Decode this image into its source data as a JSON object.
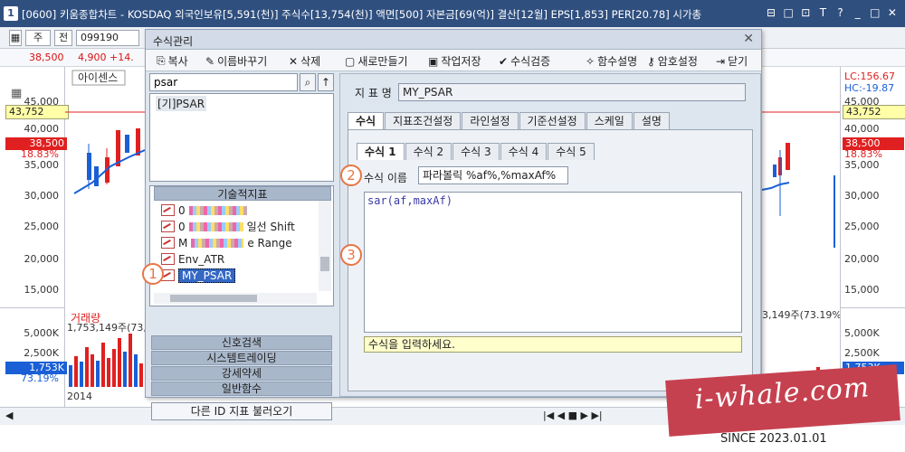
{
  "window": {
    "number": "1",
    "title": "[0600] 키움종합차트 - KOSDAQ 외국인보유[5,591(천)] 주식수[13,754(천)] 액면[500] 자본금[69(억)] 결산[12월] EPS[1,853] PER[20.78] 시가총",
    "controls": [
      "⊟",
      "□",
      "⊡",
      "T",
      "?",
      "_",
      "□",
      "✕"
    ]
  },
  "toolbar": {
    "period": "주",
    "prev_label": "전",
    "stock_code": "099190"
  },
  "pricebar": {
    "price": "38,500",
    "change": "4,900 +14."
  },
  "chart": {
    "legend_label": "아이센스",
    "price_axis": [
      "45,000",
      "40,000",
      "35,000",
      "30,000",
      "25,000",
      "20,000",
      "15,000"
    ],
    "highlight_high": "43,752",
    "highlight_price": "38,500",
    "highlight_pct": "18.83%",
    "lc_label": "LC:156.67",
    "hc_label": "HC:-19.87",
    "volume_label": "거래량",
    "volume_value_left": "1,753,149주(73,",
    "volume_value_right": "3,149주(73.19%)",
    "volume_axis": [
      "5,000K",
      "2,500K"
    ],
    "volume_highlight": "1,753K",
    "volume_pct": "73.19%",
    "year_label": "2014",
    "colors": {
      "up": "#e02020",
      "down": "#1a5fd6",
      "highlight_blue": "#1a5fd6",
      "highlight_red": "#e02020"
    }
  },
  "dialog": {
    "title": "수식관리",
    "close": "✕",
    "toolbar": [
      {
        "icon": "copy-icon",
        "glyph": "⎘",
        "label": "복사"
      },
      {
        "icon": "rename-icon",
        "glyph": "✎",
        "label": "이름바꾸기"
      },
      {
        "icon": "delete-icon",
        "glyph": "✕",
        "label": "삭제"
      },
      {
        "icon": "new-icon",
        "glyph": "▢",
        "label": "새로만들기"
      },
      {
        "icon": "save-icon",
        "glyph": "▣",
        "label": "작업저장"
      },
      {
        "icon": "check-icon",
        "glyph": "✔",
        "label": "수식검증"
      },
      {
        "icon": "wand-icon",
        "glyph": "✧",
        "label": "함수설명"
      },
      {
        "icon": "key-icon",
        "glyph": "⚷",
        "label": "암호설정"
      },
      {
        "icon": "exit-icon",
        "glyph": "⇥",
        "label": "닫기"
      }
    ],
    "left": {
      "search_value": "psar",
      "search_icon": "⌕",
      "up_icon": "↑",
      "result_item": "[기]PSAR",
      "tech_header": "기술적지표",
      "tree_items": [
        {
          "prefix": "0",
          "suffix": ""
        },
        {
          "prefix": "0",
          "suffix": "일선 Shift"
        },
        {
          "prefix": "M",
          "suffix": "e Range"
        },
        {
          "prefix": "Env_ATR",
          "suffix": ""
        }
      ],
      "selected_item": "MY_PSAR",
      "groups": [
        "신호검색",
        "시스템트레이딩",
        "강세약세",
        "일반함수"
      ],
      "load_other": "다른 ID 지표 불러오기"
    },
    "right": {
      "indicator_name_label": "지 표 명",
      "indicator_name": "MY_PSAR",
      "tabs": [
        "수식",
        "지표조건설정",
        "라인설정",
        "기준선설정",
        "스케일",
        "설명"
      ],
      "subtabs": [
        "수식 1",
        "수식 2",
        "수식 3",
        "수식 4",
        "수식 5"
      ],
      "formula_name_label": "수식 이름",
      "formula_name": "파라볼릭 %af%,%maxAf%",
      "formula": "sar(af,maxAf)",
      "hint": "수식을 입력하세요."
    },
    "badges": [
      "1",
      "2",
      "3"
    ]
  },
  "watermark": {
    "text": "i-whale.com",
    "since": "SINCE 2023.01.01"
  }
}
